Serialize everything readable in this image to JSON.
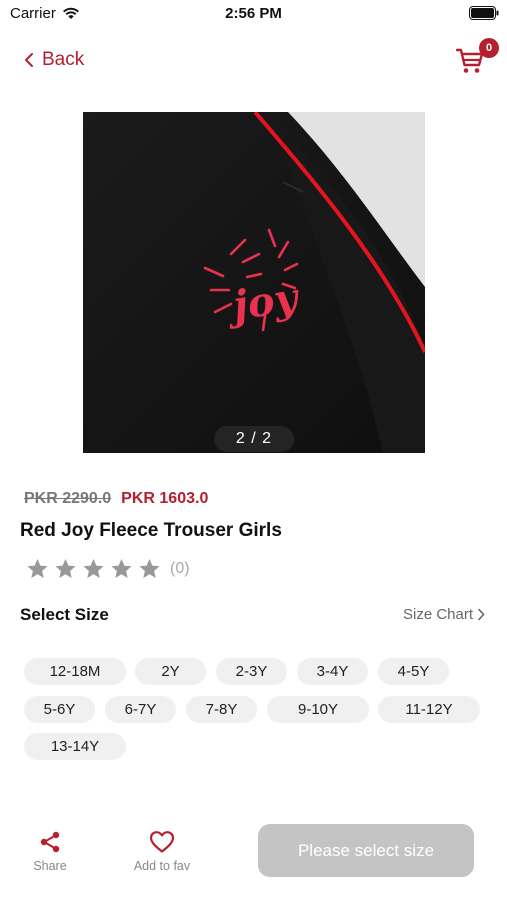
{
  "status_bar": {
    "carrier": "Carrier",
    "time": "2:56 PM"
  },
  "header": {
    "back_label": "Back",
    "cart_count": "0"
  },
  "gallery": {
    "counter": "2 / 2",
    "colors": {
      "fabric": "#141414",
      "piping": "#e3141f",
      "print": "#e8324f"
    }
  },
  "product": {
    "price_original": "PKR 2290.0",
    "price_sale": "PKR 1603.0",
    "title": "Red Joy Fleece Trouser Girls",
    "rating": 0,
    "review_count": "(0)"
  },
  "sizes": {
    "label": "Select Size",
    "chart_label": "Size Chart",
    "options": [
      "12-18M",
      "2Y",
      "2-3Y",
      "3-4Y",
      "4-5Y",
      "5-6Y",
      "6-7Y",
      "7-8Y",
      "9-10Y",
      "11-12Y",
      "13-14Y"
    ]
  },
  "actions": {
    "share_label": "Share",
    "fav_label": "Add to fav",
    "cta_label": "Please select size"
  },
  "colors": {
    "accent": "#b5202e",
    "cta_disabled": "#c4c4c4",
    "chip_bg": "#f0f0f0",
    "star": "#999999"
  }
}
